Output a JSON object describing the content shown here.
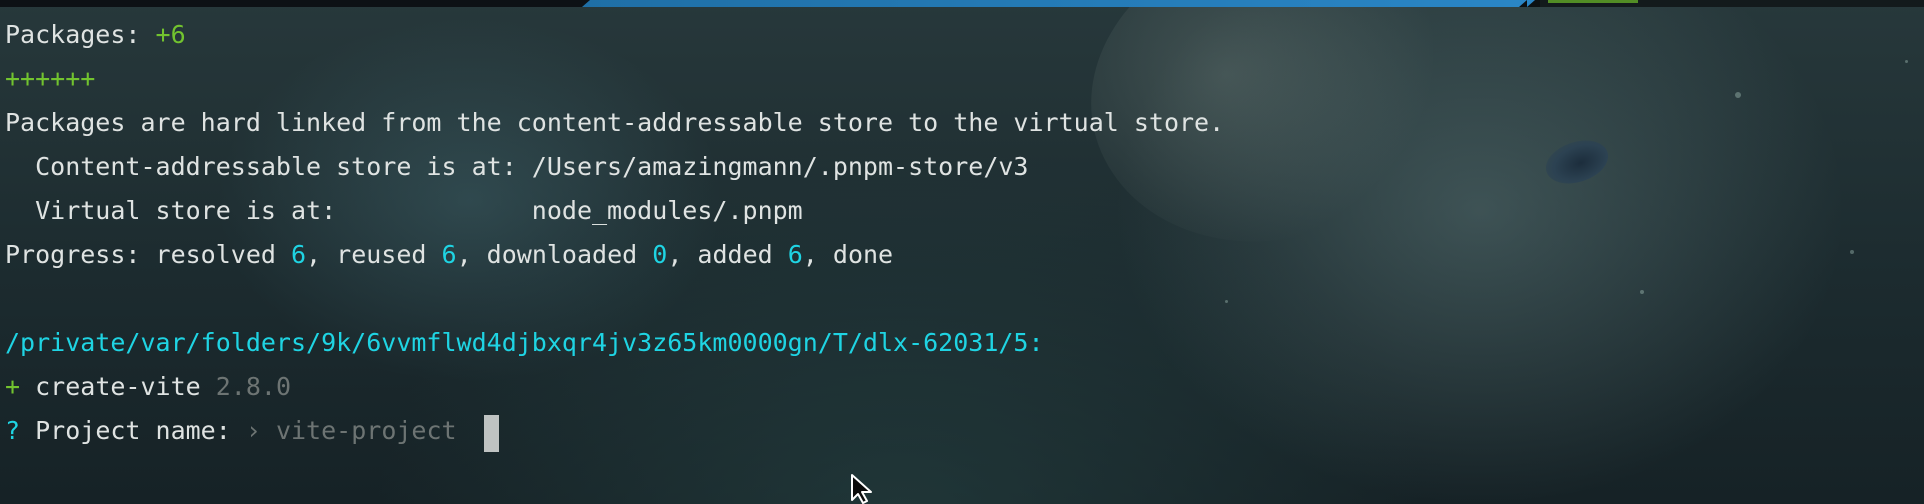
{
  "terminal": {
    "packages": {
      "label": "Packages:",
      "count": "+6"
    },
    "plus_bar": "++++++",
    "hardlink_msg": "Packages are hard linked from the content-addressable store to the virtual store.",
    "store_line": "  Content-addressable store is at: /Users/amazingmann/.pnpm-store/v3",
    "virtual_line": "  Virtual store is at:             node_modules/.pnpm",
    "progress": {
      "label": "Progress: resolved ",
      "resolved": "6",
      "reused_label": ", reused ",
      "reused": "6",
      "downloaded_label": ", downloaded ",
      "downloaded": "0",
      "added_label": ", added ",
      "added": "6",
      "done_label": ", done"
    },
    "path": "/private/var/folders/9k/6vvmflwd4djbxqr4jv3z65km0000gn/T/dlx-62031/5:",
    "create_line": {
      "plus": "+",
      "package": " create-vite ",
      "version": "2.8.0"
    },
    "prompt": {
      "q": "?",
      "label": " Project name: ",
      "arrow": "›",
      "placeholder": " vite-project"
    }
  },
  "colors": {
    "green": "#72c32f",
    "cyan": "#1fd4e3",
    "text": "#dfe3e2",
    "dim": "#6d7473"
  }
}
